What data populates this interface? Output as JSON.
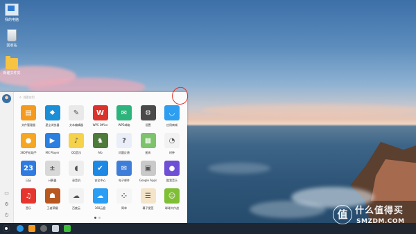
{
  "desktop": {
    "icons": [
      {
        "label": "我的电脑",
        "icon": "computer-icon"
      },
      {
        "label": "回收站",
        "icon": "recycle-bin-icon"
      },
      {
        "label": "新建文件夹",
        "icon": "folder-icon"
      }
    ]
  },
  "launcher": {
    "search_placeholder": "搜索应用",
    "apps": [
      {
        "label": "文件管理器",
        "icon": "file-manager-icon",
        "color": "#f39a1f",
        "glyph": "▤"
      },
      {
        "label": "星尘浏览器",
        "icon": "browser-icon",
        "color": "#1a8fd8",
        "glyph": "✸"
      },
      {
        "label": "文本编辑器",
        "icon": "text-editor-icon",
        "color": "#e9e9e9",
        "glyph": "✎"
      },
      {
        "label": "WPS Office",
        "icon": "wps-office-icon",
        "color": "#d9332b",
        "glyph": "W"
      },
      {
        "label": "WPS邮箱",
        "icon": "wps-mail-icon",
        "color": "#2db37c",
        "glyph": "✉"
      },
      {
        "label": "设置",
        "icon": "settings-icon",
        "color": "#4a4a4a",
        "glyph": "⚙"
      },
      {
        "label": "应用商城",
        "icon": "app-store-icon",
        "color": "#2e9ef0",
        "glyph": "◡"
      },
      {
        "label": "360手机助手",
        "icon": "360-assistant-icon",
        "color": "#f5a623",
        "glyph": "●"
      },
      {
        "label": "MX Player",
        "icon": "mx-player-icon",
        "color": "#2b7fe0",
        "glyph": "▶"
      },
      {
        "label": "QQ音乐",
        "icon": "qq-music-icon",
        "color": "#f6d24a",
        "glyph": "♪"
      },
      {
        "label": "Afo",
        "icon": "game-character-icon",
        "color": "#4e7a3a",
        "glyph": "♞"
      },
      {
        "label": "问题反馈",
        "icon": "feedback-icon",
        "color": "#e9eef8",
        "glyph": "?"
      },
      {
        "label": "图库",
        "icon": "gallery-icon",
        "color": "#7cc36b",
        "glyph": "▦"
      },
      {
        "label": "时钟",
        "icon": "clock-icon",
        "color": "#f2f2f2",
        "glyph": "◔"
      },
      {
        "label": "日历",
        "icon": "calendar-icon",
        "color": "#2f7be0",
        "glyph": "23"
      },
      {
        "label": "计算器",
        "icon": "calculator-icon",
        "color": "#d8d8d8",
        "glyph": "±"
      },
      {
        "label": "录音机",
        "icon": "recorder-icon",
        "color": "#eeeeee",
        "glyph": "◖"
      },
      {
        "label": "安全中心",
        "icon": "security-center-icon",
        "color": "#1e88e5",
        "glyph": "✔"
      },
      {
        "label": "电子邮件",
        "icon": "email-icon",
        "color": "#3f7ed8",
        "glyph": "✉"
      },
      {
        "label": "Google Apps",
        "icon": "google-apps-icon",
        "color": "#c9c9c9",
        "glyph": "▣"
      },
      {
        "label": "酷我音乐",
        "icon": "kuwo-music-icon",
        "color": "#6f4fd6",
        "glyph": "●"
      },
      {
        "label": "音乐",
        "icon": "music-icon",
        "color": "#e5352d",
        "glyph": "♫"
      },
      {
        "label": "王者荣耀",
        "icon": "honor-of-kings-icon",
        "color": "#b8571f",
        "glyph": "☗"
      },
      {
        "label": "百度云",
        "icon": "baidu-cloud-icon",
        "color": "#f2f2f2",
        "glyph": "☁"
      },
      {
        "label": "360云盘",
        "icon": "360-cloud-icon",
        "color": "#2a9df4",
        "glyph": "☁"
      },
      {
        "label": "简单",
        "icon": "jiandan-icon",
        "color": "#f5f5f5",
        "glyph": "⁘"
      },
      {
        "label": "幕子便签",
        "icon": "notes-icon",
        "color": "#f4e4c9",
        "glyph": "☰"
      },
      {
        "label": "球球大作战",
        "icon": "ball-game-icon",
        "color": "#7fbf35",
        "glyph": "☺"
      }
    ],
    "page_indicator": {
      "current": 1,
      "total": 2
    }
  },
  "watermark": {
    "badge": "值",
    "cn": "什么值得买",
    "en": "SMZDM.COM"
  },
  "colors": {
    "annotation": "#e0302c",
    "taskbar": "#1c2430",
    "launcher_bg": "#fbfbfb"
  }
}
